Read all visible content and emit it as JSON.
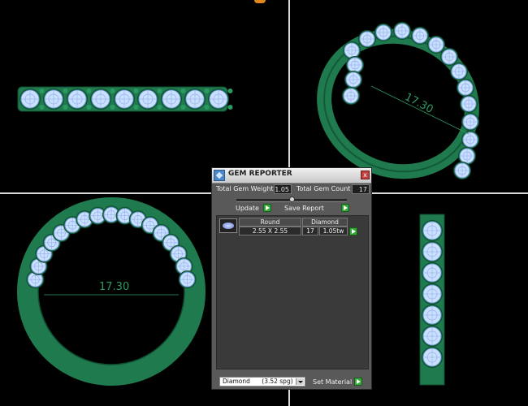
{
  "viewports": {
    "top_right_dimension": "17.30",
    "bottom_left_dimension": "17.30"
  },
  "gem_reporter": {
    "title": "GEM REPORTER",
    "close_glyph": "x",
    "total_gem_weight_label": "Total Gem Weight",
    "total_gem_weight_value": "1.05",
    "total_gem_count_label": "Total Gem Count",
    "total_gem_count_value": "17",
    "update_label": "Update",
    "save_report_label": "Save Report",
    "table": {
      "shape_header": "Round",
      "material_header": "Diamond",
      "size": "2.55 X 2.55",
      "count": "17",
      "weight": "1.05tw"
    },
    "material_select_value": "Diamond",
    "material_select_spg": "(3.52 spg)",
    "set_material_label": "Set Material"
  },
  "colors": {
    "metal": "#1f7a4e",
    "gem": "#c9e0ff",
    "panel_bg": "#595959",
    "accent_green": "#37a83a"
  }
}
